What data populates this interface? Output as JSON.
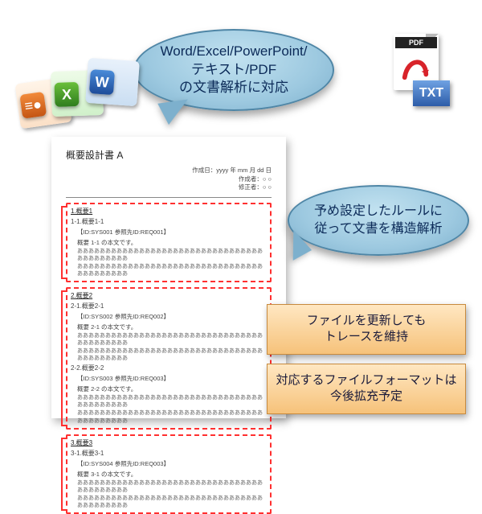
{
  "office_badges": {
    "ppt": "≡●",
    "xls": "X",
    "doc": "W"
  },
  "pdf_label": "PDF",
  "txt_label": "TXT",
  "bubble1": {
    "line1": "Word/Excel/PowerPoint/",
    "line2": "テキスト/PDF",
    "line3": "の文書解析に対応"
  },
  "bubble2": {
    "line1": "予め設定したルールに",
    "line2": "従って文書を構造解析"
  },
  "document": {
    "title": "概要設計書 A",
    "meta": {
      "created_date_label": "作成日：yyyy 年 mm 月 dd 日",
      "creator_label": "作成者：○ ○",
      "updater_label": "修正者：○ ○"
    },
    "filler": "ああああああああああああああああああああああああああああああああああああああああああ",
    "sections": [
      {
        "heading": "1.概要1",
        "sub": "1-1.概要1-1",
        "ref": "【ID:SYS001 参照先ID:REQ001】",
        "caption": "概要 1-1 の本文です。"
      },
      {
        "heading": "2.概要2",
        "sub": "2-1.概要2-1",
        "ref": "【ID:SYS002 参照先ID:REQ002】",
        "caption": "概要 2-1 の本文です。",
        "sub2": "2-2.概要2-2",
        "ref2": "【ID:SYS003 参照先ID:REQ003】",
        "caption2": "概要 2-2 の本文です。"
      },
      {
        "heading": "3.概要3",
        "sub": "3-1.概要3-1",
        "ref": "【ID:SYS004 参照先ID:REQ003】",
        "caption": "概要 3-1 の本文です。"
      }
    ]
  },
  "infobox1": {
    "line1": "ファイルを更新しても",
    "line2": "トレースを維持"
  },
  "infobox2": {
    "line1": "対応するファイルフォーマットは",
    "line2": "今後拡充予定"
  },
  "colors": {
    "bubble_border": "#4f86a6",
    "dash_red": "#ff3030",
    "info_grad_top": "#ffe7c2",
    "info_grad_bottom": "#f6c27a"
  }
}
